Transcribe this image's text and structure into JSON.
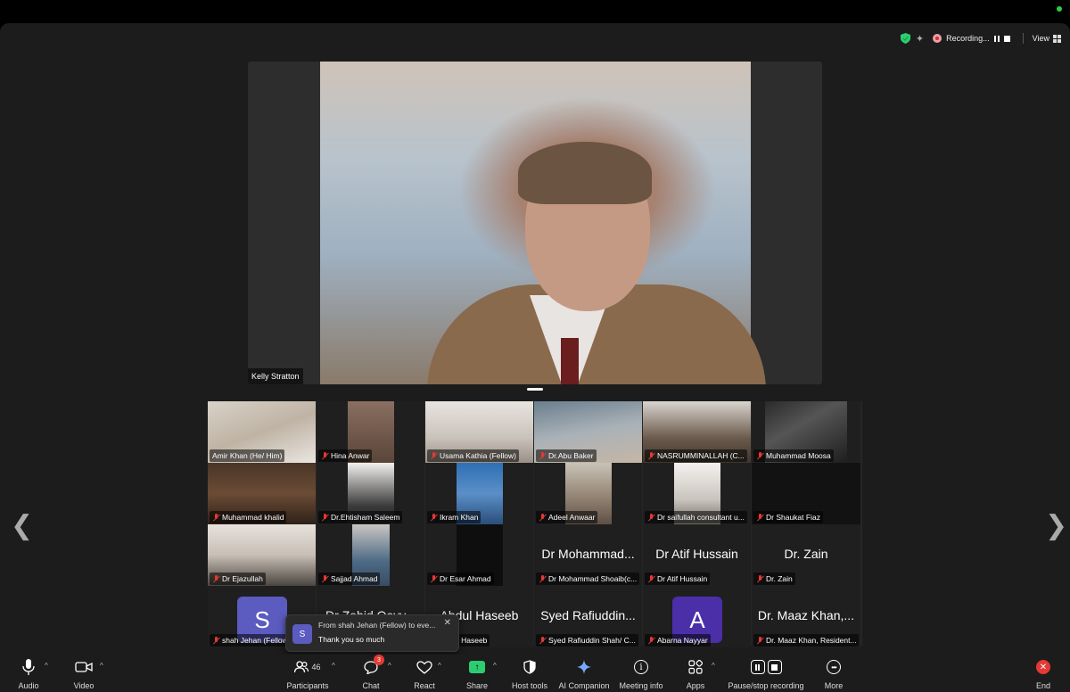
{
  "status": {
    "recording_label": "Recording...",
    "view_label": "View"
  },
  "speaker": {
    "name": "Kelly Stratton"
  },
  "gallery": {
    "tiles": [
      {
        "name": "Amir Khan (He/ Him)",
        "muted": false
      },
      {
        "name": "Hina Anwar",
        "muted": true
      },
      {
        "name": "Usama Kathia (Fellow)",
        "muted": true
      },
      {
        "name": "Dr.Abu Baker",
        "muted": true
      },
      {
        "name": "NASRUMMINALLAH (C...",
        "muted": true
      },
      {
        "name": "Muhammad Moosa",
        "muted": true
      },
      {
        "name": "Muhammad khalid",
        "muted": true
      },
      {
        "name": "Dr.Ehtisham Saleem",
        "muted": true
      },
      {
        "name": "Ikram Khan",
        "muted": true
      },
      {
        "name": "Adeel Anwaar",
        "muted": true
      },
      {
        "name": "Dr saifullah consultant u...",
        "muted": true
      },
      {
        "name": "Dr Shaukat Fiaz",
        "muted": true
      },
      {
        "name": "Dr Ejazullah",
        "muted": true
      },
      {
        "name": "Sajjad Ahmad",
        "muted": true
      },
      {
        "name": "Dr Esar Ahmad",
        "muted": true
      },
      {
        "name": "Dr Mohammad Shoaib(c...",
        "muted": true,
        "display_name": "Dr Mohammad..."
      },
      {
        "name": "Dr Atif Hussain",
        "muted": true,
        "display_name": "Dr Atif Hussain"
      },
      {
        "name": "Dr. Zain",
        "muted": true,
        "display_name": "Dr. Zain"
      },
      {
        "name": "shah Jehan (Fellow)",
        "muted": true,
        "avatar_letter": "S"
      },
      {
        "name": "Dr Zahid Qayy...",
        "muted": true,
        "display_name": "Dr Zahid Qayy..."
      },
      {
        "name": "Abdul Haseeb",
        "muted": true,
        "display_name": "Abdul Haseeb"
      },
      {
        "name": "Syed Rafiuddin Shah/ C...",
        "muted": true,
        "display_name": "Syed Rafiuddin..."
      },
      {
        "name": "Abarna Nayyar",
        "muted": true,
        "avatar_letter": "A"
      },
      {
        "name": "Dr. Maaz Khan, Resident...",
        "muted": true,
        "display_name": "Dr. Maaz Khan,..."
      }
    ]
  },
  "chat_toast": {
    "avatar_letter": "S",
    "from": "From shah Jehan (Fellow) to eve...",
    "message": "Thank you so much"
  },
  "toolbar": {
    "audio": "Audio",
    "video": "Video",
    "participants": "Participants",
    "participants_count": "46",
    "chat": "Chat",
    "chat_badge": "3",
    "react": "React",
    "share": "Share",
    "host_tools": "Host tools",
    "ai_companion": "AI Companion",
    "meeting_info": "Meeting info",
    "apps": "Apps",
    "pause_stop": "Pause/stop recording",
    "more": "More",
    "end": "End"
  },
  "colors": {
    "window_bg": "#1c1c1c",
    "gallery_bg": "#262626",
    "mute_red": "#e53935",
    "share_green": "#2ecc71",
    "avatar_purple_1": "#5b5bc0",
    "avatar_purple_2": "#4a2fa8"
  }
}
